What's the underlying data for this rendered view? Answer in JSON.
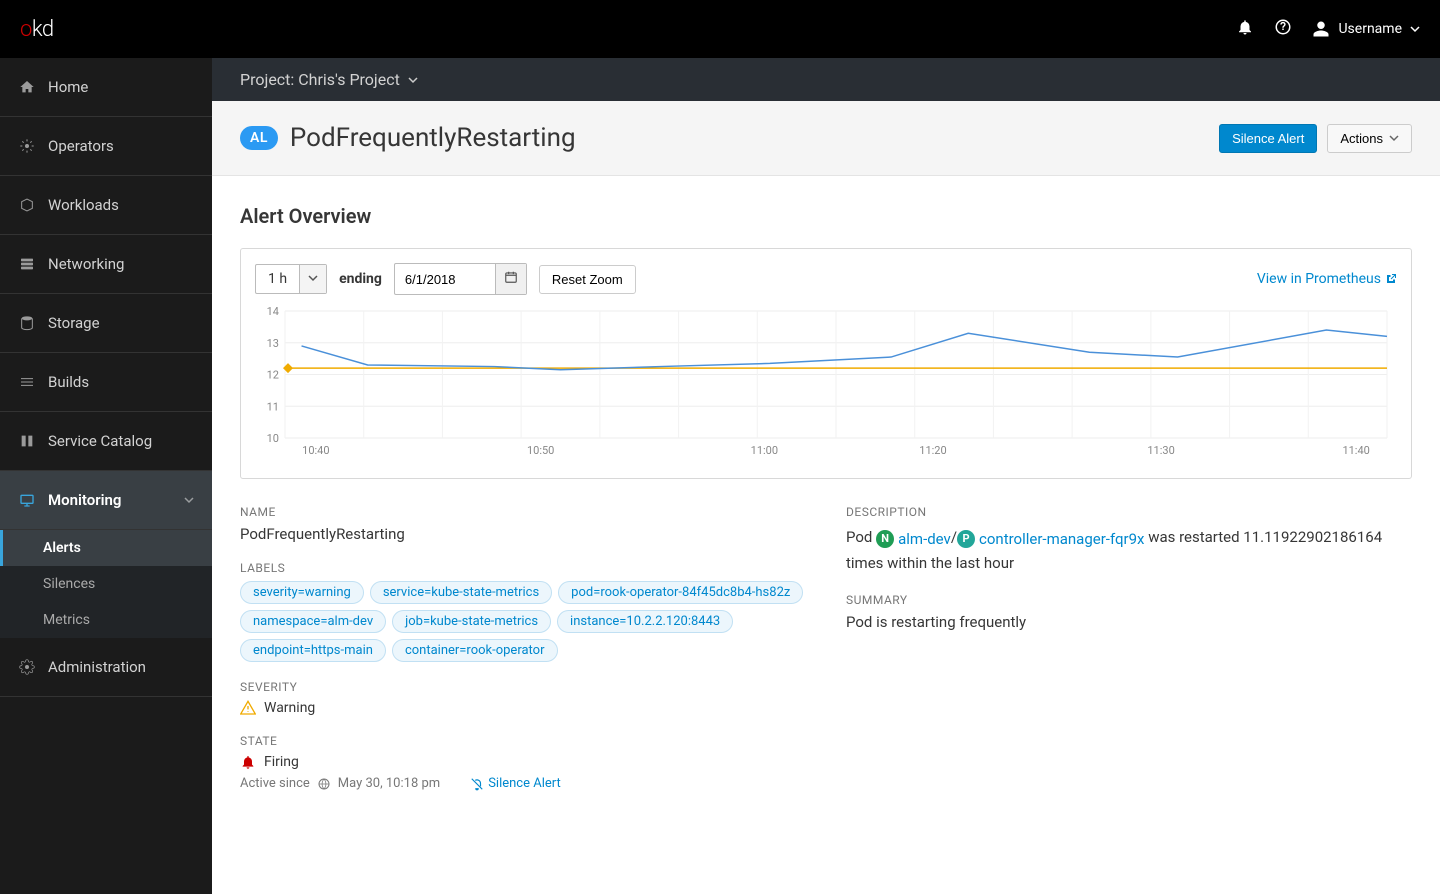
{
  "topbar": {
    "logo_o": "o",
    "logo_kd": "kd",
    "username": "Username"
  },
  "sidebar": {
    "items": [
      {
        "label": "Home"
      },
      {
        "label": "Operators"
      },
      {
        "label": "Workloads"
      },
      {
        "label": "Networking"
      },
      {
        "label": "Storage"
      },
      {
        "label": "Builds"
      },
      {
        "label": "Service Catalog"
      },
      {
        "label": "Monitoring"
      },
      {
        "label": "Administration"
      }
    ],
    "monitoring_sub": [
      {
        "label": "Alerts"
      },
      {
        "label": "Silences"
      },
      {
        "label": "Metrics"
      }
    ]
  },
  "project_bar": "Project: Chris's Project",
  "header": {
    "badge": "AL",
    "title": "PodFrequentlyRestarting",
    "silence_btn": "Silence Alert",
    "actions_btn": "Actions"
  },
  "overview_title": "Alert Overview",
  "controls": {
    "range": "1 h",
    "ending_label": "ending",
    "date": "6/1/2018",
    "reset": "Reset Zoom",
    "prom_link": "View in Prometheus"
  },
  "chart_data": {
    "type": "line",
    "ylim": [
      10,
      14
    ],
    "y_ticks": [
      10,
      11,
      12,
      13,
      14
    ],
    "x_ticks": [
      "10:40",
      "10:50",
      "11:00",
      "11:20",
      "11:30",
      "11:40"
    ],
    "x_tick_positions": [
      0.028,
      0.232,
      0.435,
      0.588,
      0.795,
      0.972
    ],
    "threshold": 12.2,
    "series": [
      {
        "name": "value",
        "color": "#4a90d9",
        "points": [
          {
            "x": 0.015,
            "y": 12.9
          },
          {
            "x": 0.075,
            "y": 12.3
          },
          {
            "x": 0.19,
            "y": 12.25
          },
          {
            "x": 0.25,
            "y": 12.15
          },
          {
            "x": 0.34,
            "y": 12.25
          },
          {
            "x": 0.44,
            "y": 12.35
          },
          {
            "x": 0.55,
            "y": 12.55
          },
          {
            "x": 0.62,
            "y": 13.3
          },
          {
            "x": 0.73,
            "y": 12.7
          },
          {
            "x": 0.81,
            "y": 12.55
          },
          {
            "x": 0.945,
            "y": 13.4
          },
          {
            "x": 1.0,
            "y": 13.2
          }
        ]
      }
    ]
  },
  "details": {
    "name_label": "NAME",
    "name": "PodFrequentlyRestarting",
    "labels_label": "LABELS",
    "labels": [
      "severity=warning",
      "service=kube-state-metrics",
      "pod=rook-operator-84f45dc8b4-hs82z",
      "namespace=alm-dev",
      "job=kube-state-metrics",
      "instance=10.2.2.120:8443",
      "endpoint=https-main",
      "container=rook-operator"
    ],
    "severity_label": "SEVERITY",
    "severity": "Warning",
    "state_label": "STATE",
    "state": "Firing",
    "active_since_label": "Active since",
    "active_since": "May 30, 10:18 pm",
    "silence_link": "Silence Alert",
    "desc_label": "DESCRIPTION",
    "desc_pre": "Pod ",
    "ns_link": "alm-dev",
    "pod_link": "controller-manager-fqr9x",
    "desc_post": " was restarted 11.11922902186164 times within the last hour",
    "summary_label": "SUMMARY",
    "summary": "Pod is restarting frequently"
  }
}
